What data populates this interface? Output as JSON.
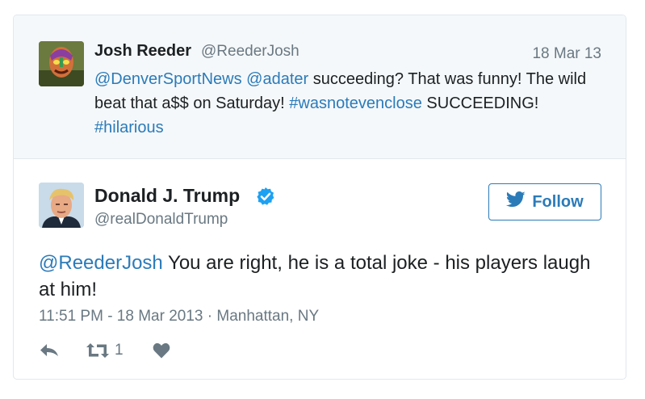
{
  "parent_tweet": {
    "name": "Josh Reeder",
    "handle": "@ReederJosh",
    "date": "18 Mar 13",
    "mention1": "@DenverSportNews",
    "mention2": "@adater",
    "text_part1": " succeeding? That was funny! The wild beat that a$$ on Saturday! ",
    "hashtag1": "#wasnotevenclose",
    "text_part2": " SUCCEEDING! ",
    "hashtag2": "#hilarious"
  },
  "main_tweet": {
    "name": "Donald J. Trump",
    "handle": "@realDonaldTrump",
    "follow_label": "Follow",
    "mention": "@ReederJosh",
    "text": " You are right, he is a total joke - his players laugh at him!",
    "timestamp": "11:51 PM - 18 Mar 2013",
    "separator": " · ",
    "location": "Manhattan, NY",
    "retweet_count": "1"
  },
  "colors": {
    "link": "#2b7bb9",
    "muted": "#697882",
    "text": "#1c2022",
    "parent_bg": "#f5f8fa",
    "verified": "#1da1f2"
  },
  "icons": [
    "twitter-bird-icon",
    "verified-badge-icon",
    "reply-icon",
    "retweet-icon",
    "like-heart-icon"
  ]
}
